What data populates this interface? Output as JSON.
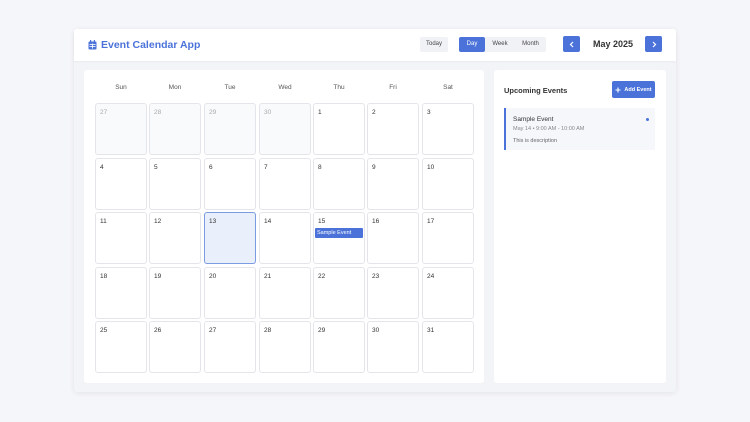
{
  "header": {
    "app_title": "Event Calendar App",
    "brand_icon": "calendar-icon",
    "today_label": "Today",
    "views": [
      {
        "label": "Day",
        "active": true
      },
      {
        "label": "Week",
        "active": false
      },
      {
        "label": "Month",
        "active": false
      }
    ],
    "month_title": "May 2025",
    "prev_icon": "chevron-left-icon",
    "next_icon": "chevron-right-icon"
  },
  "calendar": {
    "weekdays": [
      "Sun",
      "Mon",
      "Tue",
      "Wed",
      "Thu",
      "Fri",
      "Sat"
    ],
    "weeks": [
      [
        {
          "day": "27",
          "other": true
        },
        {
          "day": "28",
          "other": true
        },
        {
          "day": "29",
          "other": true
        },
        {
          "day": "30",
          "other": true
        },
        {
          "day": "1"
        },
        {
          "day": "2"
        },
        {
          "day": "3"
        }
      ],
      [
        {
          "day": "4"
        },
        {
          "day": "5"
        },
        {
          "day": "6"
        },
        {
          "day": "7"
        },
        {
          "day": "8"
        },
        {
          "day": "9"
        },
        {
          "day": "10"
        }
      ],
      [
        {
          "day": "11"
        },
        {
          "day": "12"
        },
        {
          "day": "13",
          "today": true
        },
        {
          "day": "14"
        },
        {
          "day": "15",
          "event": "Sample Event"
        },
        {
          "day": "16"
        },
        {
          "day": "17"
        }
      ],
      [
        {
          "day": "18"
        },
        {
          "day": "19"
        },
        {
          "day": "20"
        },
        {
          "day": "21"
        },
        {
          "day": "22"
        },
        {
          "day": "23"
        },
        {
          "day": "24"
        }
      ],
      [
        {
          "day": "25"
        },
        {
          "day": "26"
        },
        {
          "day": "27"
        },
        {
          "day": "28"
        },
        {
          "day": "29"
        },
        {
          "day": "30"
        },
        {
          "day": "31"
        }
      ]
    ]
  },
  "sidebar": {
    "title": "Upcoming Events",
    "add_button_label": "Add Event",
    "events": [
      {
        "title": "Sample Event",
        "time": "May 14 • 9:00 AM - 10:00 AM",
        "description": "This is description"
      }
    ]
  },
  "colors": {
    "accent": "#4a72d9",
    "today_bg": "#eaf0fb",
    "page_bg": "#f5f6fa"
  }
}
